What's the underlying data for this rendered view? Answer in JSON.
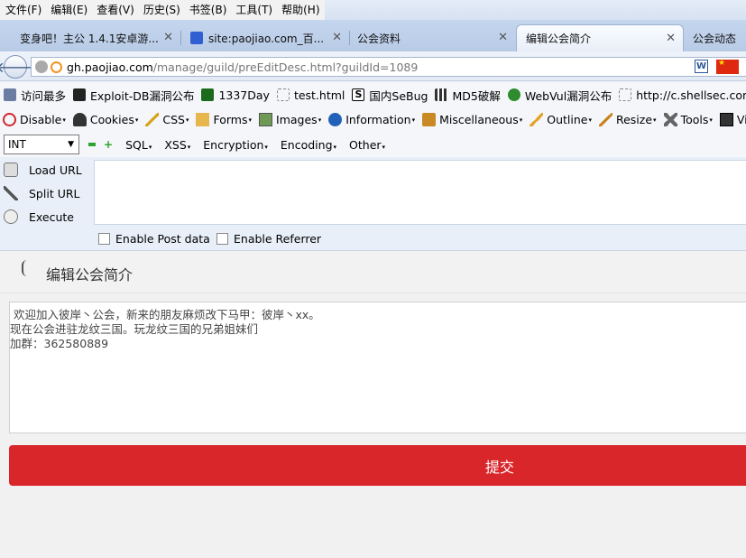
{
  "menu": [
    "文件(F)",
    "编辑(E)",
    "查看(V)",
    "历史(S)",
    "书签(B)",
    "工具(T)",
    "帮助(H)"
  ],
  "tabs": [
    {
      "label": "变身吧！主公 1.4.1安卓游..."
    },
    {
      "label": "site:paojiao.com_百..."
    },
    {
      "label": "公会资料"
    },
    {
      "label": "编辑公会简介"
    },
    {
      "label": "公会动态"
    }
  ],
  "url": {
    "host": "gh.paojiao.com",
    "path": "/manage/guild/preEditDesc.html?guildId=1089"
  },
  "bookmarks": [
    "访问最多",
    "Exploit-DB漏洞公布",
    "1337Day",
    "test.html",
    "国内SeBug",
    "MD5破解",
    "WebVul漏洞公布",
    "http://c.shellsec.com..."
  ],
  "devtools": [
    "Disable",
    "Cookies",
    "CSS",
    "Forms",
    "Images",
    "Information",
    "Miscellaneous",
    "Outline",
    "Resize",
    "Tools",
    "View S"
  ],
  "hackbar": {
    "select_value": "INT",
    "menus": [
      "SQL",
      "XSS",
      "Encryption",
      "Encoding",
      "Other"
    ],
    "buttons": [
      "Load URL",
      "Split URL",
      "Execute"
    ],
    "post_label": "Enable Post data",
    "referrer_label": "Enable Referrer"
  },
  "page": {
    "title": "编辑公会简介",
    "desc_lines": [
      "欢迎加入彼岸丶公会，新来的朋友麻烦改下马甲：彼岸丶xx。",
      "现在公会进驻龙纹三国。玩龙纹三国的兄弟姐妹们",
      "加群：362580889"
    ],
    "submit_label": "提交"
  }
}
